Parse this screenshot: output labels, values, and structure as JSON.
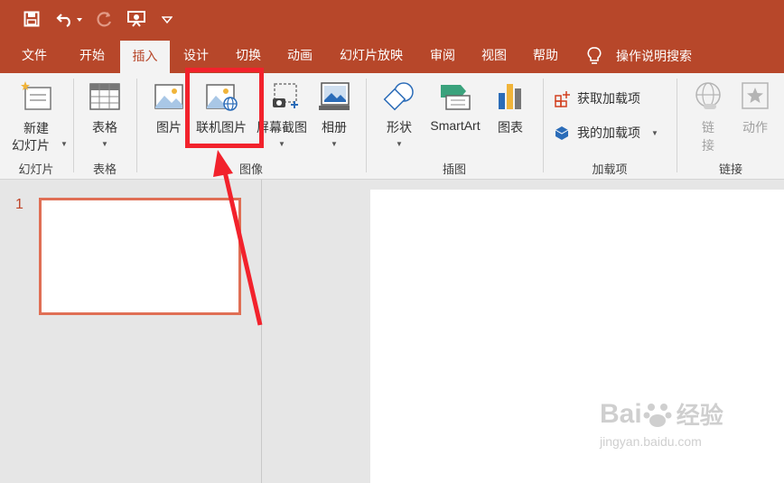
{
  "qat": {
    "save_icon": "save-icon",
    "undo_icon": "undo-icon",
    "redo_icon": "redo-icon",
    "present_icon": "present-icon",
    "customize_icon": "customize-icon"
  },
  "tabs": [
    {
      "label": "文件"
    },
    {
      "label": "开始"
    },
    {
      "label": "插入"
    },
    {
      "label": "设计"
    },
    {
      "label": "切换"
    },
    {
      "label": "动画"
    },
    {
      "label": "幻灯片放映"
    },
    {
      "label": "审阅"
    },
    {
      "label": "视图"
    },
    {
      "label": "帮助"
    }
  ],
  "active_tab": "插入",
  "search": {
    "label": "操作说明搜索",
    "icon": "lightbulb-icon"
  },
  "ribbon": {
    "new_slide": {
      "line1": "新建",
      "line2": "幻灯片"
    },
    "table": {
      "label": "表格"
    },
    "picture": {
      "label": "图片"
    },
    "online_picture": {
      "label": "联机图片"
    },
    "screenshot": {
      "label": "屏幕截图"
    },
    "album": {
      "label": "相册"
    },
    "shapes": {
      "label": "形状"
    },
    "smartart": {
      "label": "SmartArt"
    },
    "chart": {
      "label": "图表"
    },
    "get_addins": {
      "label": "获取加载项"
    },
    "my_addins": {
      "label": "我的加载项"
    },
    "link": {
      "line1": "链",
      "line2": "接"
    },
    "action": {
      "label": "动作"
    },
    "groups": {
      "slides": "幻灯片",
      "tables": "表格",
      "images": "图像",
      "illustrations": "插图",
      "addins": "加载项",
      "links": "链接"
    }
  },
  "thumbnail": {
    "number": "1"
  },
  "watermark": {
    "brand": "Bai",
    "brand2": "经验",
    "url": "jingyan.baidu.com"
  },
  "colors": {
    "accent": "#b7472a",
    "highlight": "#f2222c",
    "thumb_border": "#e06f55"
  }
}
